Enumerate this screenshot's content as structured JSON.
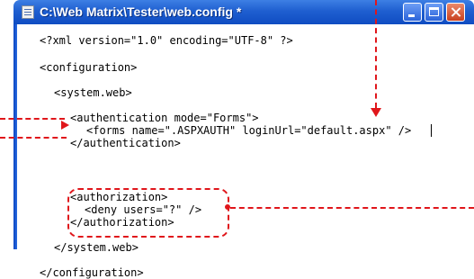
{
  "window": {
    "title": "C:\\Web Matrix\\Tester\\web.config *",
    "icon": "config-file-icon",
    "controls": [
      "minimize-icon",
      "maximize-icon",
      "close-icon"
    ]
  },
  "editor": {
    "lines": [
      "<?xml version=\"1.0\" encoding=\"UTF-8\" ?>",
      "<configuration>",
      "<system.web>",
      "<authentication mode=\"Forms\">",
      "<forms name=\".ASPXAUTH\" loginUrl=\"default.aspx\" />",
      "</authentication>",
      "<authorization>",
      "<deny users=\"?\" />",
      "</authorization>",
      "</system.web>",
      "</configuration>"
    ]
  },
  "colors": {
    "annotation": "#e0161b",
    "titlebar": "#1f5fd0"
  }
}
